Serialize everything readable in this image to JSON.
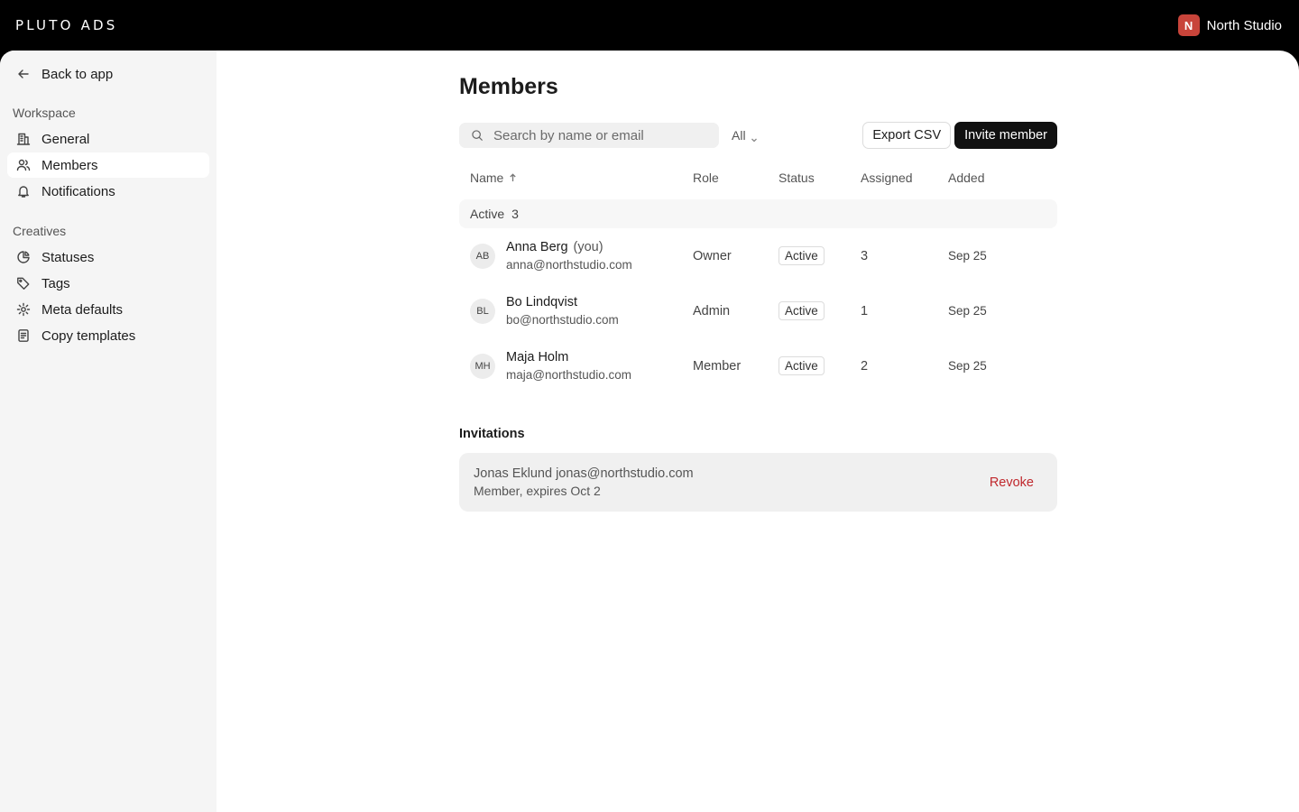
{
  "topbar": {
    "logo": "PLUTO ADS",
    "workspace": {
      "initial": "N",
      "name": "North Studio",
      "color": "#c8443a"
    }
  },
  "sidebar": {
    "back_label": "Back to app",
    "sections": [
      {
        "label": "Workspace",
        "items": [
          {
            "label": "General",
            "icon": "building-icon"
          },
          {
            "label": "Members",
            "icon": "users-icon",
            "active": true
          },
          {
            "label": "Notifications",
            "icon": "bell-icon"
          }
        ]
      },
      {
        "label": "Creatives",
        "items": [
          {
            "label": "Statuses",
            "icon": "pie-icon"
          },
          {
            "label": "Tags",
            "icon": "tag-icon"
          },
          {
            "label": "Meta defaults",
            "icon": "gear-icon"
          },
          {
            "label": "Copy templates",
            "icon": "document-icon"
          }
        ]
      }
    ]
  },
  "main": {
    "title": "Members",
    "search_placeholder": "Search by name or email",
    "filter_label": "All",
    "export_label": "Export CSV",
    "invite_label": "Invite member",
    "columns": {
      "name": "Name",
      "role": "Role",
      "status": "Status",
      "assigned": "Assigned",
      "added": "Added"
    },
    "group": {
      "label": "Active",
      "count": "3"
    },
    "members": [
      {
        "initials": "AB",
        "name": "Anna Berg",
        "you": "(you)",
        "email": "anna@northstudio.com",
        "role": "Owner",
        "status": "Active",
        "assigned": "3",
        "added": "Sep 25"
      },
      {
        "initials": "BL",
        "name": "Bo Lindqvist",
        "you": "",
        "email": "bo@northstudio.com",
        "role": "Admin",
        "status": "Active",
        "assigned": "1",
        "added": "Sep 25"
      },
      {
        "initials": "MH",
        "name": "Maja Holm",
        "you": "",
        "email": "maja@northstudio.com",
        "role": "Member",
        "status": "Active",
        "assigned": "2",
        "added": "Sep 25"
      }
    ],
    "invitations": {
      "title": "Invitations",
      "items": [
        {
          "line1": "Jonas Eklund jonas@northstudio.com",
          "line2": "Member, expires Oct 2",
          "action": "Revoke"
        }
      ]
    }
  }
}
